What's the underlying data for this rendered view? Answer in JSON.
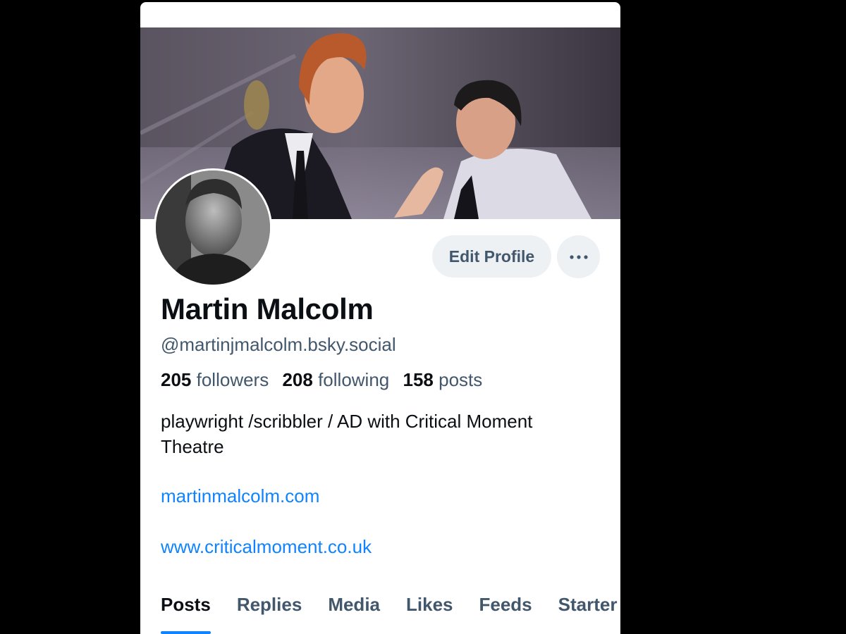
{
  "profile": {
    "display_name": "Martin Malcolm",
    "handle": "@martinjmalcolm.bsky.social",
    "stats": {
      "followers_count": "205",
      "followers_label": "followers",
      "following_count": "208",
      "following_label": "following",
      "posts_count": "158",
      "posts_label": "posts"
    },
    "bio_line1": "playwright /scribbler / AD with Critical Moment",
    "bio_line2": "Theatre",
    "links": [
      "martinmalcolm.com",
      "www.criticalmoment.co.uk"
    ]
  },
  "actions": {
    "edit_label": "Edit Profile",
    "more_icon": "ellipsis-icon"
  },
  "tabs": [
    {
      "label": "Posts",
      "active": true
    },
    {
      "label": "Replies",
      "active": false
    },
    {
      "label": "Media",
      "active": false
    },
    {
      "label": "Likes",
      "active": false
    },
    {
      "label": "Feeds",
      "active": false
    },
    {
      "label": "Starter Packs",
      "active": false
    }
  ],
  "colors": {
    "accent": "#1083fe",
    "text_primary": "#0b0f14",
    "text_secondary": "#42576c",
    "button_bg": "#eef1f4",
    "background": "#000000"
  }
}
